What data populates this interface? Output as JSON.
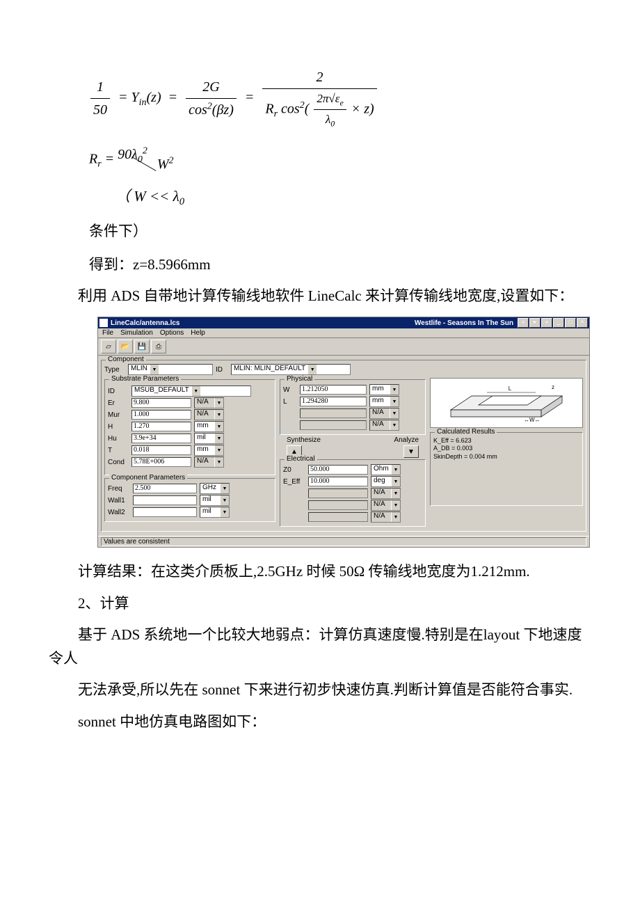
{
  "formula1_plain": "1/50 = Y_in(z) = 2G / cos²(βz) = 2 / ( R_r cos²( (2π√ε_e / λ_0) × z ) )",
  "formula2_plain": "R_r = 90 λ_0² / W²",
  "cond_line": "（ W << λ_0",
  "cond_line2": "条件下）",
  "result_line": "得到：z=8.5966mm",
  "para_linecalc_intro": "利用 ADS 自带地计算传输线地软件 LineCalc 来计算传输线地宽度,设置如下：",
  "para_result": "计算结果：在这类介质板上,2.5GHz 时候 50Ω 传输线地宽度为1.212mm.",
  "heading2": "2、计算",
  "para_weak": "基于 ADS 系统地一个比较大地弱点：计算仿真速度慢.特别是在layout 下地速度令人",
  "para_sonnet": "无法承受,所以先在 sonnet 下来进行初步快速仿真.判断计算值是否能符合事实.",
  "para_circuit": "sonnet 中地仿真电路图如下：",
  "linecalc": {
    "title_left": "LineCalc/antenna.lcs",
    "title_right": "Westlife - Seasons In The Sun",
    "menu": {
      "file": "File",
      "simulation": "Simulation",
      "options": "Options",
      "help": "Help"
    },
    "component": {
      "legend": "Component",
      "type_label": "Type",
      "type_value": "MLIN",
      "id_label": "ID",
      "id_value": "MLIN: MLIN_DEFAULT"
    },
    "substrate": {
      "legend": "Substrate Parameters",
      "id_label": "ID",
      "id_value": "MSUB_DEFAULT",
      "rows": [
        {
          "label": "Er",
          "value": "9.800",
          "unit": "N/A",
          "unit_disabled": true
        },
        {
          "label": "Mur",
          "value": "1.000",
          "unit": "N/A",
          "unit_disabled": true
        },
        {
          "label": "H",
          "value": "1.270",
          "unit": "mm",
          "unit_disabled": false
        },
        {
          "label": "Hu",
          "value": "3.9e+34",
          "unit": "mil",
          "unit_disabled": false
        },
        {
          "label": "T",
          "value": "0.018",
          "unit": "mm",
          "unit_disabled": false
        },
        {
          "label": "Cond",
          "value": "5.78E+006",
          "unit": "N/A",
          "unit_disabled": true
        }
      ]
    },
    "component_params": {
      "legend": "Component Parameters",
      "rows": [
        {
          "label": "Freq",
          "value": "2.500",
          "unit": "GHz",
          "unit_disabled": false
        },
        {
          "label": "Wall1",
          "value": "",
          "unit": "mil",
          "unit_disabled": false
        },
        {
          "label": "Wall2",
          "value": "",
          "unit": "mil",
          "unit_disabled": false
        }
      ]
    },
    "physical": {
      "legend": "Physical",
      "rows": [
        {
          "label": "W",
          "value": "1.212050",
          "unit": "mm",
          "unit_disabled": false
        },
        {
          "label": "L",
          "value": "1.294280",
          "unit": "mm",
          "unit_disabled": false
        },
        {
          "label": "",
          "value": "",
          "unit": "N/A",
          "unit_disabled": true,
          "disabled": true
        },
        {
          "label": "",
          "value": "",
          "unit": "N/A",
          "unit_disabled": true,
          "disabled": true
        }
      ]
    },
    "synth_label": "Synthesize",
    "analyze_label": "Analyze",
    "electrical": {
      "legend": "Electrical",
      "rows": [
        {
          "label": "Z0",
          "value": "50.000",
          "unit": "Ohm",
          "unit_disabled": false
        },
        {
          "label": "E_Eff",
          "value": "10.000",
          "unit": "deg",
          "unit_disabled": false
        },
        {
          "label": "",
          "value": "",
          "unit": "N/A",
          "unit_disabled": true,
          "disabled": true
        },
        {
          "label": "",
          "value": "",
          "unit": "N/A",
          "unit_disabled": true,
          "disabled": true
        },
        {
          "label": "",
          "value": "",
          "unit": "N/A",
          "unit_disabled": true,
          "disabled": true
        }
      ]
    },
    "results": {
      "legend": "Calculated Results",
      "lines": [
        "K_Eff = 6.623",
        "A_DB = 0.003",
        "SkinDepth = 0.004 mm"
      ]
    },
    "diagram_labels": {
      "L": "L",
      "W": "W",
      "arrow": "↔"
    },
    "status": "Values are consistent"
  }
}
